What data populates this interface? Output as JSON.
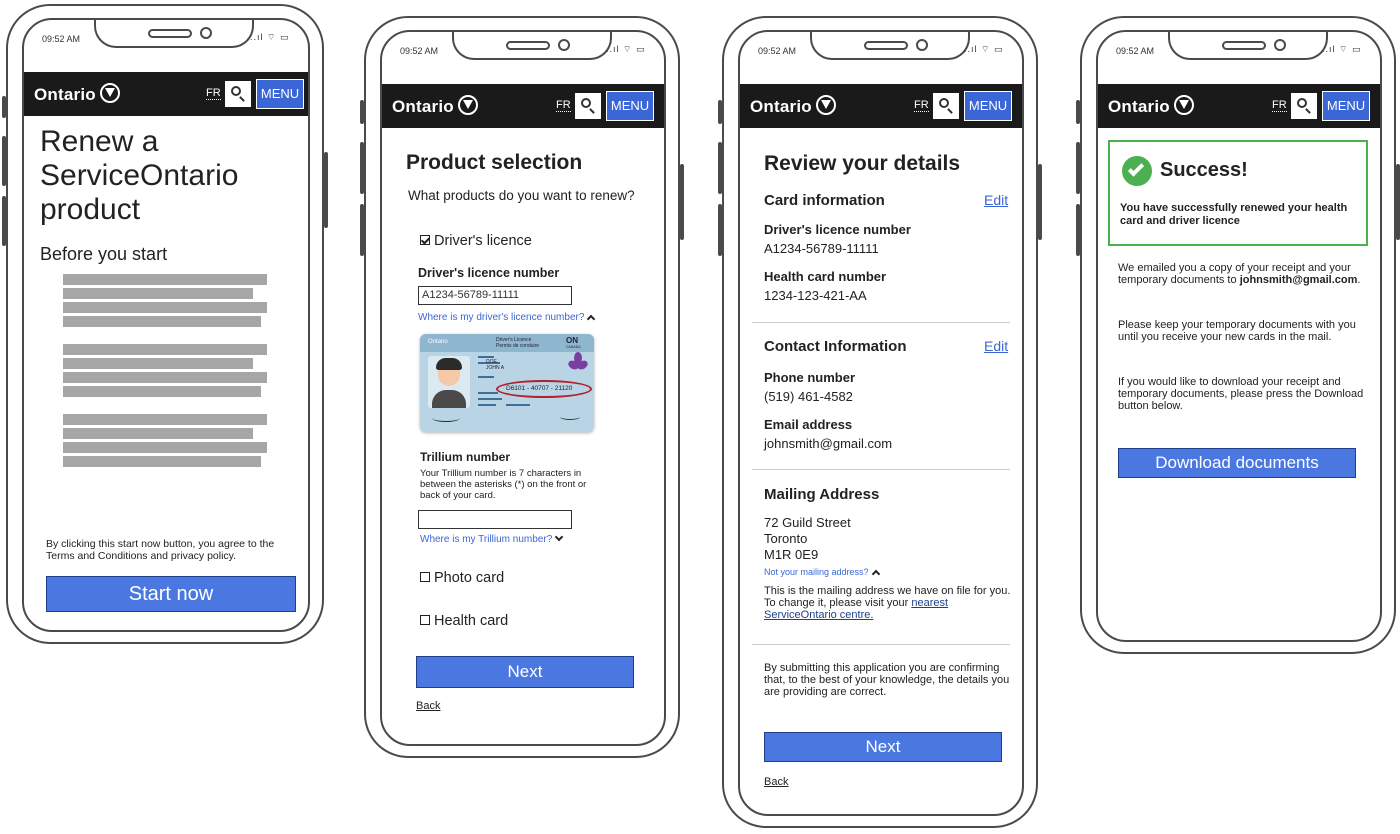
{
  "status_bar": {
    "time": "09:52 AM",
    "signal": "..ıl ⌔ ▭"
  },
  "header": {
    "logo": "Ontario",
    "lang": "FR",
    "menu": "MENU"
  },
  "screen1": {
    "title": "Renew a ServiceOntario product",
    "subtitle": "Before you start",
    "terms": "By clicking this start now button, you agree to the Terms and Conditions and privacy policy.",
    "start_button": "Start now"
  },
  "screen2": {
    "title": "Product selection",
    "question": "What products do you want to renew?",
    "driver_option": "Driver's licence",
    "dl_number_label": "Driver's licence number",
    "dl_number_value": "A1234-56789-11111",
    "dl_where_link": "Where is my driver's licence number?",
    "card": {
      "brand": "Ontario",
      "title": "Driver's Licence",
      "subtitle": "Permis de conduire",
      "province": "ON",
      "country": "CANADA",
      "name1": "DOE,",
      "name2": "JOHN A",
      "number": "D6101 - 40707 - 21120"
    },
    "trillium_label": "Trillium number",
    "trillium_help": "Your Trillium number is 7 characters in between the asterisks (*) on the front or back of your card.",
    "trillium_value": "",
    "trillium_link": "Where is my Trillium number?",
    "photo_option": "Photo card",
    "health_option": "Health card",
    "next_button": "Next",
    "back_link": "Back"
  },
  "screen3": {
    "title": "Review your details",
    "card_section": "Card information",
    "edit1": "Edit",
    "dl_label": "Driver's licence number",
    "dl_value": "A1234-56789-11111",
    "health_label": "Health card number",
    "health_value": "1234-123-421-AA",
    "contact_section": "Contact Information",
    "edit2": "Edit",
    "phone_label": "Phone number",
    "phone_value": "(519) 461-4582",
    "email_label": "Email address",
    "email_value": "johnsmith@gmail.com",
    "mailing_section": "Mailing Address",
    "addr1": "72 Guild Street",
    "addr2": "Toronto",
    "addr3": "M1R 0E9",
    "not_your_link": "Not your mailing address?",
    "mailing_note": "This is the mailing address we have on file for you. To change it, please visit your",
    "mailing_note_link": "nearest ServiceOntario centre.",
    "confirm": "By submitting this application you are confirming that, to the best of your knowledge, the details you are providing are correct.",
    "next_button": "Next",
    "back_link": "Back"
  },
  "screen4": {
    "success_title": "Success!",
    "success_msg": "You have successfully renewed your health card and driver licence",
    "emailed": "We emailed you a copy of your receipt and your temporary documents to",
    "email": "johnsmith@gmail.com",
    "email_end": ".",
    "keep": "Please keep your temporary documents with you until you receive your new cards in the mail.",
    "download_info": "If you would like to download your receipt and temporary documents, please press the Download button below.",
    "download_button": "Download documents"
  },
  "colors": {
    "primary": "#4a78e0",
    "header": "#1a1a1a",
    "success": "#4caf50",
    "text": "#222222"
  }
}
